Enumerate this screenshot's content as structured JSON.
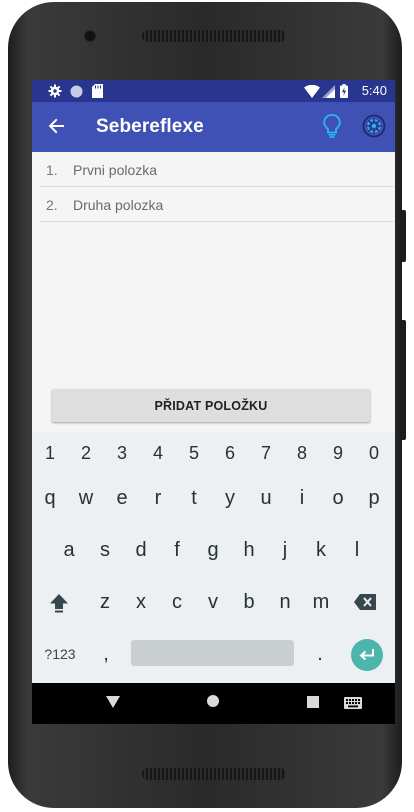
{
  "status_bar": {
    "time": "5:40",
    "icons": [
      "gear-icon",
      "circle-icon",
      "sd-card-icon",
      "wifi-icon",
      "cell-signal-icon",
      "battery-icon"
    ]
  },
  "app_bar": {
    "title": "Sebereflexe",
    "icons": [
      "back-arrow-icon",
      "lightbulb-icon",
      "reflex-icon"
    ]
  },
  "list": {
    "items": [
      {
        "number": "1.",
        "text": "Prvni polozka"
      },
      {
        "number": "2.",
        "text": "Druha polozka"
      }
    ]
  },
  "add_button": {
    "label": "PŘIDAT POLOŽKU"
  },
  "keyboard": {
    "number_row": [
      "1",
      "2",
      "3",
      "4",
      "5",
      "6",
      "7",
      "8",
      "9",
      "0"
    ],
    "row1": [
      "q",
      "w",
      "e",
      "r",
      "t",
      "y",
      "u",
      "i",
      "o",
      "p"
    ],
    "row2": [
      "a",
      "s",
      "d",
      "f",
      "g",
      "h",
      "j",
      "k",
      "l"
    ],
    "row3": [
      "z",
      "x",
      "c",
      "v",
      "b",
      "n",
      "m"
    ],
    "symbols_key": "?123",
    "comma_key": ",",
    "period_key": ".",
    "icons": [
      "shift-icon",
      "backspace-icon",
      "enter-icon"
    ]
  },
  "nav_bar": {
    "icons": [
      "back-triangle-icon",
      "home-circle-icon",
      "recents-square-icon",
      "keyboard-switch-icon"
    ]
  },
  "colors": {
    "primary": "#3f51b5",
    "primary_dark": "#293690",
    "accent": "#4db6ac"
  }
}
